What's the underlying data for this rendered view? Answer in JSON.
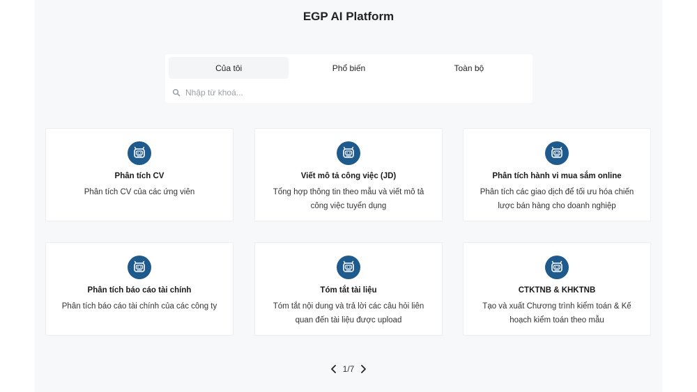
{
  "app": {
    "title": "EGP AI Platform"
  },
  "tabs": [
    {
      "label": "Của tôi",
      "active": true
    },
    {
      "label": "Phổ biến",
      "active": false
    },
    {
      "label": "Toàn bộ",
      "active": false
    }
  ],
  "search": {
    "placeholder": "Nhập từ khoá...",
    "value": ""
  },
  "cards": [
    {
      "title": "Phân tích CV",
      "description": "Phân tích CV của các ứng viên",
      "icon": "robot-icon"
    },
    {
      "title": "Viết mô tả công việc (JD)",
      "description": "Tổng hợp thông tin theo mẫu và viết mô tả công việc tuyển dụng",
      "icon": "robot-icon"
    },
    {
      "title": "Phân tích hành vi mua sắm online",
      "description": "Phân tích các giao dịch để tối ưu hóa chiến lược bán hàng cho doanh nghiệp",
      "icon": "robot-icon"
    },
    {
      "title": "Phân tích báo cáo tài chính",
      "description": "Phân tích báo cáo tài chính của các công ty",
      "icon": "robot-icon"
    },
    {
      "title": "Tóm tắt tài liệu",
      "description": "Tóm tắt nội dung và trả lời các câu hỏi liên quan đến tài liệu được upload",
      "icon": "robot-icon"
    },
    {
      "title": "CTKTNB & KHKTNB",
      "description": "Tạo và xuất Chương trình kiểm toán & Kế hoạch kiểm toán theo mẫu",
      "icon": "robot-icon"
    }
  ],
  "pagination": {
    "label": "1/7"
  },
  "colors": {
    "accent": "#1f5a8c",
    "background": "#f7f8fa",
    "card": "#ffffff"
  }
}
